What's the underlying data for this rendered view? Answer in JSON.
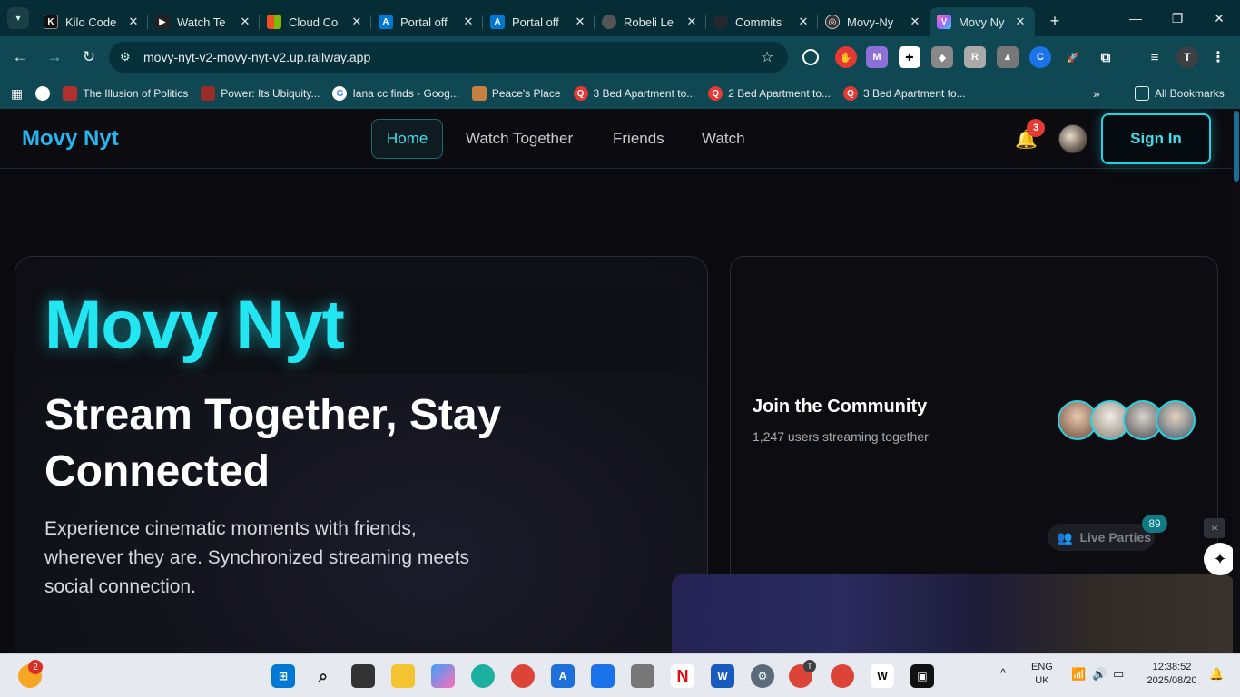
{
  "browser": {
    "tabs": [
      {
        "title": "Kilo Code",
        "icon": "kilo-icon",
        "color": "#111111"
      },
      {
        "title": "Watch Te",
        "icon": "watch-icon",
        "color": "#222222"
      },
      {
        "title": "Cloud Co",
        "icon": "microsoft-icon",
        "color": "#f25022"
      },
      {
        "title": "Portal off",
        "icon": "azure-icon",
        "color": "#0078d4"
      },
      {
        "title": "Portal off",
        "icon": "azure-icon",
        "color": "#0078d4"
      },
      {
        "title": "Robeli Le",
        "icon": "globe-icon",
        "color": "#555555"
      },
      {
        "title": "Commits",
        "icon": "github-icon",
        "color": "#24292f"
      },
      {
        "title": "Movy-Ny",
        "icon": "movy-icon",
        "color": "#333333"
      },
      {
        "title": "Movy Ny",
        "icon": "movy-v-icon",
        "color": "#a060ff",
        "active": true
      }
    ],
    "url": "movy-nyt-v2-movy-nyt-v2.up.railway.app",
    "profile_initial": "T",
    "bookmarks": [
      {
        "label": "The Illusion of Politics",
        "icon": "page-icon",
        "color": "#b03030"
      },
      {
        "label": "Power: Its Ubiquity...",
        "icon": "page-icon",
        "color": "#9a2b2b"
      },
      {
        "label": "Iana cc finds - Goog...",
        "icon": "google-icon",
        "color": "#4285f4"
      },
      {
        "label": "Peace's Place",
        "icon": "page-icon",
        "color": "#c88040"
      },
      {
        "label": "3 Bed Apartment to...",
        "icon": "q-icon",
        "color": "#e53935"
      },
      {
        "label": "2 Bed Apartment to...",
        "icon": "q-icon",
        "color": "#e53935"
      },
      {
        "label": "3 Bed Apartment to...",
        "icon": "q-icon",
        "color": "#e53935"
      }
    ],
    "all_bookmarks": "All Bookmarks"
  },
  "site": {
    "logo": "Movy Nyt",
    "nav": [
      "Home",
      "Watch Together",
      "Friends",
      "Watch"
    ],
    "notifications": "3",
    "signin": "Sign In"
  },
  "hero": {
    "title": "Movy Nyt",
    "subtitle": "Stream Together, Stay Connected",
    "description": "Experience cinematic moments with friends, wherever they are. Synchronized streaming meets social connection."
  },
  "community": {
    "title": "Join the Community",
    "users": "1,247 users streaming together"
  },
  "live_parties": {
    "label": "Live Parties",
    "count": "89"
  },
  "taskbar": {
    "weather_badge": "2",
    "lang": "ENG",
    "region": "UK",
    "time": "12:38:52",
    "date": "2025/08/20",
    "chrome_badge": "T"
  },
  "colors": {
    "accent": "#22e6f2",
    "browser_frame": "#062d36",
    "toolbar": "#0f4852"
  }
}
